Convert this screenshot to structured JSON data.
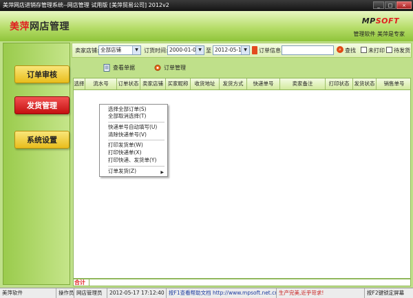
{
  "window": {
    "title": "美萍网店进销存管理系统--网店管理 试用版 [美萍贸易公司] 2012v2",
    "buttons": {
      "minimize": "_",
      "maximize": "□",
      "close": "×"
    }
  },
  "header": {
    "logo_brand": "美萍",
    "logo_rest": "网店管理",
    "vendor_a": "MP",
    "vendor_b": "SOFT",
    "slogan": "管理软件  美萍是专家"
  },
  "sidebar": {
    "items": [
      {
        "label": "订单审核",
        "active": false
      },
      {
        "label": "发货管理",
        "active": true
      },
      {
        "label": "系统设置",
        "active": false
      }
    ]
  },
  "filters": {
    "store_label": "卖家店铺:",
    "store_value": "全部店铺",
    "time_label": "订货时间:",
    "date_from": "2000-01-01",
    "to_label": "至",
    "date_to": "2012-05-17",
    "info_label": "订单信息:",
    "info_value": "",
    "search_label": "查找",
    "unprinted_label": "未打印",
    "pending_ship_label": "待发货"
  },
  "toolbar": {
    "view_order": "查看单据",
    "order_manage": "订单管理"
  },
  "grid": {
    "columns": [
      "选择",
      "流水号",
      "订单状态",
      "卖家店铺",
      "买家昵称",
      "收货地址",
      "发货方式",
      "快递单号",
      "卖家备注",
      "打印状态",
      "发货状态",
      "销售单号"
    ]
  },
  "totals": {
    "label": "合计"
  },
  "context_menu": {
    "items": [
      "选择全部订单(S)",
      "全部取消选择(T)",
      "快递单号自动填写(U)",
      "清除快递单号(V)",
      "打印发货单(W)",
      "打印快递单(X)",
      "打印快递、发货单(Y)",
      "订单发货(Z)"
    ]
  },
  "statusbar": {
    "app": "美萍软件",
    "operator_label": "操作员",
    "operator": "网店管理员",
    "datetime": "2012-05-17  17:12:40",
    "help": "按F1查看帮助文档 http://www.mpsoft.net.cn",
    "motto": "生产完美,近乎苛求!",
    "lock": "按F2键锁定屏幕"
  },
  "colors": {
    "accent_red": "#e02020",
    "nav_yellow": "#e9bd1c",
    "header_green": "#8fc43a"
  }
}
